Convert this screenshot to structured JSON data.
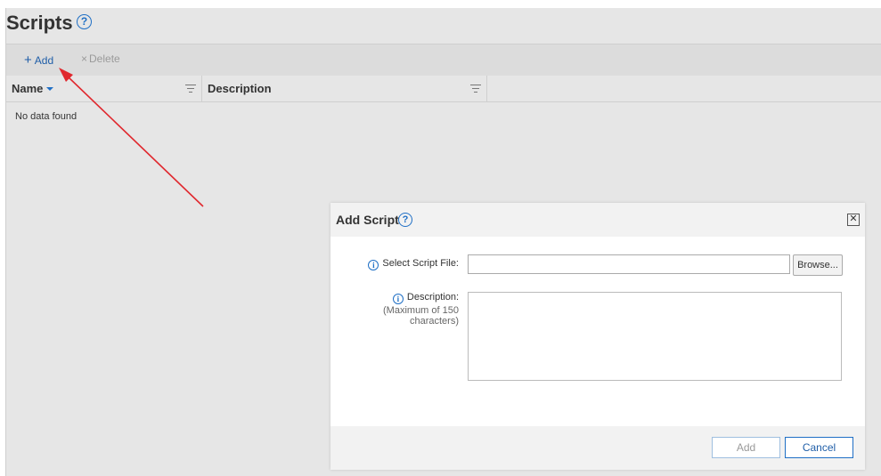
{
  "page": {
    "title": "Scripts",
    "help_glyph": "?"
  },
  "toolbar": {
    "add_label": "Add",
    "add_icon": "plus-icon",
    "delete_label": "Delete",
    "delete_icon": "close-icon"
  },
  "grid": {
    "columns": [
      {
        "label": "Name",
        "sorted": "descending"
      },
      {
        "label": "Description"
      }
    ],
    "empty_message": "No data found"
  },
  "dialog": {
    "title": "Add Script",
    "close_glyph": "✕",
    "fields": {
      "file_label": "Select Script File:",
      "file_value": "",
      "browse_label": "Browse...",
      "description_label": "Description:",
      "description_hint_line1": "(Maximum of 150",
      "description_hint_line2": "characters)",
      "description_value": ""
    },
    "footer": {
      "add_label": "Add",
      "cancel_label": "Cancel"
    }
  },
  "colors": {
    "accent": "#1f6fc5",
    "arrow": "#e0282e",
    "background": "#e6e6e6"
  }
}
